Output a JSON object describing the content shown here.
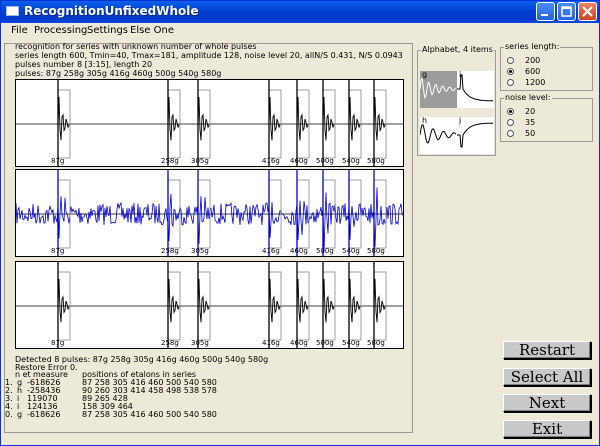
{
  "window": {
    "title": "RecognitionUnfixedWhole"
  },
  "menu": [
    "File",
    "Processing",
    "Settings",
    "Else One"
  ],
  "info": {
    "line1": "recognition for series with unknown number of whole pulses",
    "line2": "series length 600, Tmin=40, Tmax=181,  amplitude 128, noise level 20, allN/S 0.431,  N/S 0.0943",
    "line3": "pulses number 8 [3:15], length 20",
    "line4": "pulses: 87g 258g 305g 416g 460g 500g 540g 580g"
  },
  "pulses": [
    {
      "label": "87g",
      "pos": 87
    },
    {
      "label": "258g",
      "pos": 258
    },
    {
      "label": "305g",
      "pos": 305
    },
    {
      "label": "416g",
      "pos": 416
    },
    {
      "label": "460g",
      "pos": 460
    },
    {
      "label": "500g",
      "pos": 500
    },
    {
      "label": "540g",
      "pos": 540
    },
    {
      "label": "580g",
      "pos": 580
    }
  ],
  "detected": "Detected 8 pulses:  87g 258g 305g 416g 460g 500g 540g 580g",
  "restore": "Restore Error 0.",
  "table": {
    "header": {
      "n": "n et",
      "measure": "measure",
      "positions": "positions of etalons in series"
    },
    "rows": [
      {
        "n": "1.",
        "et": "g",
        "measure": "-618626",
        "positions": "87  258  305  416  460  500  540  580"
      },
      {
        "n": "2.",
        "et": "h",
        "measure": "-258436",
        "positions": "90  260  303  414  458  498  538  578"
      },
      {
        "n": "3.",
        "et": "i",
        "measure": "119070",
        "positions": "89  265  428"
      },
      {
        "n": "4.",
        "et": "i",
        "measure": "124136",
        "positions": "158  309  464"
      },
      {
        "n": "0.",
        "et": "g",
        "measure": "-618626",
        "positions": "87  258  305  416  460  500  540  580"
      }
    ]
  },
  "alphabet": {
    "label": "Alphabet, 4 items",
    "items": [
      "g",
      "i",
      "h",
      "j"
    ]
  },
  "series_length": {
    "label": "series length:",
    "options": [
      "200",
      "600",
      "1200"
    ],
    "selected": "600"
  },
  "noise_level": {
    "label": "noise level:",
    "options": [
      "20",
      "35",
      "50"
    ],
    "selected": "20"
  },
  "buttons": {
    "restart": "Restart",
    "select_all": "Select All",
    "next": "Next",
    "exit": "Exit"
  },
  "colors": {
    "signal": "#0000cc",
    "titlebar": "#0242d3",
    "panel": "#ece9d8"
  }
}
